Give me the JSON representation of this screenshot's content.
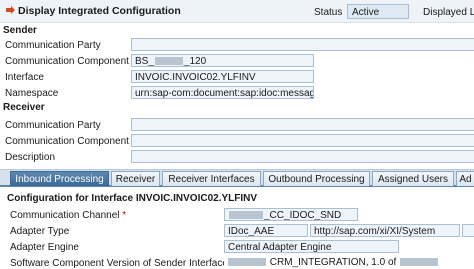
{
  "header": {
    "title": "Display Integrated Configuration",
    "status_label": "Status",
    "status_value": "Active",
    "displayed_label": "Displayed L"
  },
  "sender": {
    "section_title": "Sender",
    "rows": [
      {
        "label": "Communication Party",
        "value": ""
      },
      {
        "label": "Communication Component",
        "value_prefix": "BS_",
        "value_suffix": "_120"
      },
      {
        "label": "Interface",
        "value": "INVOIC.INVOIC02.YLFINV"
      },
      {
        "label": "Namespace",
        "value": "urn:sap-com:document:sap:idoc:messages"
      }
    ]
  },
  "receiver": {
    "section_title": "Receiver",
    "rows": [
      {
        "label": "Communication Party",
        "value": ""
      },
      {
        "label": "Communication Component",
        "value": ""
      },
      {
        "label": "Description",
        "value": ""
      }
    ]
  },
  "tabs": [
    {
      "label": "Inbound Processing",
      "active": true
    },
    {
      "label": "Receiver",
      "active": false
    },
    {
      "label": "Receiver Interfaces",
      "active": false
    },
    {
      "label": "Outbound Processing",
      "active": false
    },
    {
      "label": "Assigned Users",
      "active": false
    },
    {
      "label": "Ad",
      "active": false
    }
  ],
  "config": {
    "title": "Configuration for Interface INVOIC.INVOIC02.YLFINV",
    "communication_channel": {
      "label": "Communication Channel",
      "required_mark": "*",
      "value_suffix": "_CC_IDOC_SND"
    },
    "adapter_type": {
      "label": "Adapter Type",
      "value": "IDoc_AAE",
      "namespace": "http://sap.com/xi/XI/System"
    },
    "adapter_engine": {
      "label": "Adapter Engine",
      "value": "Central Adapter Engine"
    },
    "swcv": {
      "label": "Software Component Version of Sender Interface",
      "value": "CRM_INTEGRATION, 1.0 of"
    }
  },
  "colors": {
    "accent": "#3b6a96",
    "field_bg": "#eef4fa",
    "field_border": "#a9bfd4",
    "header_bg": "#eef3f8"
  },
  "icons": {
    "header": "config-arrow-icon"
  }
}
